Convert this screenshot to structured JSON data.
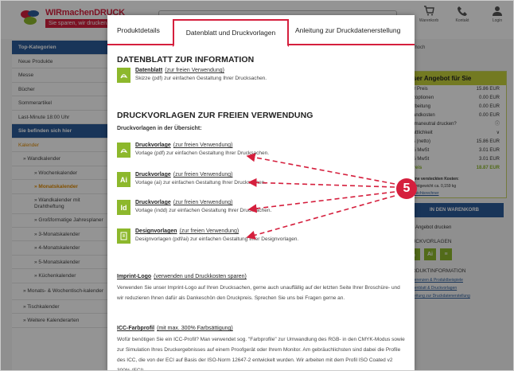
{
  "site": {
    "logo_name": "WIRmachenDRUCK",
    "logo_slogan": "Sie sparen, wir drucken.",
    "header_icons": [
      {
        "icon": "cart-icon",
        "label": "Warenkorb"
      },
      {
        "icon": "phone-icon",
        "label": "Kontakt"
      },
      {
        "icon": "user-icon",
        "label": "Login"
      }
    ]
  },
  "sidebar": {
    "items": [
      {
        "label": "Top-Kategorien",
        "style": "head"
      },
      {
        "label": "Neue Produkte",
        "style": ""
      },
      {
        "label": "Messe",
        "style": ""
      },
      {
        "label": "Bücher",
        "style": ""
      },
      {
        "label": "Sommerartikel",
        "style": ""
      },
      {
        "label": "Last-Minute 18:00 Uhr",
        "style": ""
      },
      {
        "label": "Sie befinden sich hier",
        "style": "dark"
      },
      {
        "label": "Kalender",
        "style": "orange"
      },
      {
        "label": "»  Wandkalender",
        "style": "sub"
      },
      {
        "label": "»  Wochenkalender",
        "style": "sub2"
      },
      {
        "label": "»  Monatskalender",
        "style": "sub2 active"
      },
      {
        "label": "»  Wandkalender mit Drahtheftung",
        "style": "sub2 tall"
      },
      {
        "label": "»  Großformatige Jahresplaner",
        "style": "sub2 tall"
      },
      {
        "label": "»  3-Monatskalender",
        "style": "sub2"
      },
      {
        "label": "»  4-Monatskalender",
        "style": "sub2"
      },
      {
        "label": "»  5-Monatskalender",
        "style": "sub2"
      },
      {
        "label": "»  Küchenkalender",
        "style": "sub2"
      },
      {
        "label": "»  Monats- & Wochentisch-kalender",
        "style": "sub tall3"
      },
      {
        "label": "»  Tischkalender",
        "style": "sub"
      },
      {
        "label": "»  Weitere Kalenderarten",
        "style": "sub"
      }
    ]
  },
  "right_panel": {
    "top_note": "54 hoch",
    "offer_title": "nser Angebot für Sie",
    "rows": [
      {
        "label": "ser Preis",
        "value": "15.86 EUR"
      },
      {
        "label": "atzoptionen",
        "value": "0.00 EUR"
      },
      {
        "label": "rarbeitung",
        "value": "0.00 EUR"
      },
      {
        "label": "rsandkosten",
        "value": "0.00 EUR"
      },
      {
        "label": "Klimaneutral drucken?",
        "value": "ⓘ"
      },
      {
        "label": "stattlichkeit",
        "value": "∨"
      },
      {
        "label": "ttts (netto)",
        "value": "15.86 EUR"
      },
      {
        "label": "7% MwSt",
        "value": "3.01 EUR"
      },
      {
        "label": "9% MwSt",
        "value": "3.01 EUR"
      },
      {
        "label": "tpreis",
        "value": "18.87 EUR"
      }
    ],
    "hidden_costs": "Keine versteckten Kosten:",
    "weight": "esamtgewicht ca. 0,159 kg",
    "weight_link": "Gewichtsrechner",
    "cart_button": "IN DEN WARENKORB",
    "print_offer": "Angebot drucken",
    "section_templates": "RUCKVORLAGEN",
    "section_info": "RODUKTINFORMATION",
    "info_links": [
      "Referenzen & Produktbeispiele",
      "Datenblatt & Druckvorlagen",
      "Anleitung zur Druckdatenerstellung"
    ]
  },
  "modal": {
    "tabs": [
      "Produktdetails",
      "Datenblatt und Druckvorlagen",
      "Anleitung zur Druckdatenerstellung"
    ],
    "active_tab": 1,
    "sheet_heading": "DATENBLATT ZUR INFORMATION",
    "datasheet": {
      "title": "Datenblatt",
      "ext": "(zur freien Verwendung)",
      "desc": "Skizze (pdf) zur einfachen Gestaltung Ihrer Drucksachen."
    },
    "templates_heading": "DRUCKVORLAGEN ZUR FREIEN VERWENDUNG",
    "templates_sub": "Druckvorlagen in der Übersicht:",
    "templates": [
      {
        "icon": "pdf-file-icon",
        "glyph": "",
        "title": "Druckvorlage",
        "ext": "(zur freien Verwendung)",
        "desc": "Vorlage (pdf) zur einfachen Gestaltung Ihrer Drucksachen."
      },
      {
        "icon": "illustrator-file-icon",
        "glyph": "Ai",
        "title": "Druckvorlage",
        "ext": "(zur freien Verwendung)",
        "desc": "Vorlage (ai) zur einfachen Gestaltung Ihrer Drucksachen."
      },
      {
        "icon": "indesign-file-icon",
        "glyph": "Id",
        "title": "Druckvorlage",
        "ext": "(zur freien Verwendung)",
        "desc": "Vorlage (indd) zur einfachen Gestaltung Ihrer Drucksachen."
      },
      {
        "icon": "zip-file-icon",
        "glyph": "",
        "title": "Designvorlagen",
        "ext": "(zur freien Verwendung)",
        "desc": "Designvorlagen (pdf/ai) zur einfachen Gestaltung Ihrer Designvorlagen."
      }
    ],
    "imprint_title": "Imprint-Logo",
    "imprint_ext": "(verwenden und Druckkosten sparen)",
    "imprint_text": "Verwenden Sie unser Imprint-Logo auf Ihren Drucksachen, gerne auch unauffällig auf der letzten Seite Ihrer Broschüre- und wir reduzieren Ihnen dafür als Dankeschön den Druckpreis. Sprechen Sie uns bei Fragen gerne an.",
    "icc_title": "ICC-Farbprofil",
    "icc_ext": "(mit max. 300% Farbsättigung)",
    "icc_text": "Wofür benötigen Sie ein ICC-Profil? Man verwendet sog. \"Farbprofile\" zur Umwandlung des RGB- in den CMYK-Modus sowie zur Simulation Ihres Druckergebnisses auf einem Proofgerät oder Ihrem Monitor. Am gebräuchlichsten sind dabei die Profile des ICC, die von der ECI auf Basis der ISO-Norm 12647-2 entwickelt wurden. Wir arbeiten mit dem Profil ISO Coated v2 300% (ECI)."
  },
  "annotation": {
    "number": "5",
    "color": "#d51f3d"
  }
}
